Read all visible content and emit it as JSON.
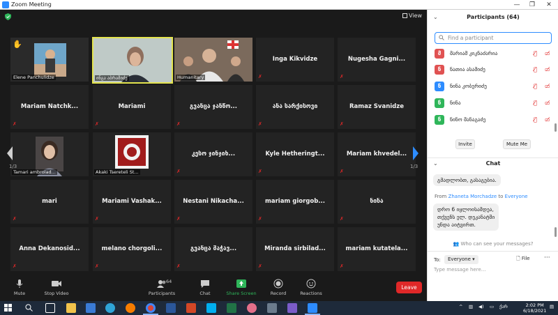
{
  "window": {
    "title": "Zoom Meeting",
    "min": "—",
    "restore": "❐",
    "close": "✕"
  },
  "stage": {
    "view_label": "View"
  },
  "tiles": [
    {
      "text": "Elene Panchulidze",
      "kind": "photo-label"
    },
    {
      "text": "ინგა აბრამიძე",
      "kind": "photo-label"
    },
    {
      "text": "Humanitary",
      "kind": "photo-label"
    },
    {
      "text": "Inga Kikvidze",
      "kind": "name"
    },
    {
      "text": "Nugesha Gagni...",
      "kind": "name"
    },
    {
      "text": "Mariam Natchk...",
      "kind": "name"
    },
    {
      "text": "Mariami",
      "kind": "name"
    },
    {
      "text": "გვანცა ჯანწო...",
      "kind": "name"
    },
    {
      "text": "ანა სარქისოვი",
      "kind": "name"
    },
    {
      "text": "Ramaz Svanidze",
      "kind": "name"
    },
    {
      "text": "Tamari ambrolad...",
      "kind": "photo-label"
    },
    {
      "text": "Akaki Tsereteli St...",
      "kind": "photo-label"
    },
    {
      "text": "კესო ჯინჯიხ...",
      "kind": "name"
    },
    {
      "text": "Kyle Hetheringt...",
      "kind": "name"
    },
    {
      "text": "Mariam khvedel...",
      "kind": "name"
    },
    {
      "text": "mari",
      "kind": "name"
    },
    {
      "text": "Mariami Vashak...",
      "kind": "name"
    },
    {
      "text": "Nestani Nikacha...",
      "kind": "name"
    },
    {
      "text": "mariam giorgob...",
      "kind": "name"
    },
    {
      "text": "ნინა",
      "kind": "name"
    },
    {
      "text": "Anna Dekanosid...",
      "kind": "name"
    },
    {
      "text": "melano chorgoli...",
      "kind": "name"
    },
    {
      "text": "გვანცა მაჭავ...",
      "kind": "name"
    },
    {
      "text": "Miranda sirbilad...",
      "kind": "name"
    },
    {
      "text": "mariam kutatela...",
      "kind": "name"
    }
  ],
  "pagination": {
    "left": "1/3",
    "right": "1/3"
  },
  "toolbar": {
    "mute": "Mute",
    "stop_video": "Stop Video",
    "participants": "Participants",
    "participants_count": "64",
    "chat": "Chat",
    "share_screen": "Share Screen",
    "record": "Record",
    "reactions": "Reactions",
    "leave": "Leave"
  },
  "participants_panel": {
    "title": "Participants (64)",
    "search_placeholder": "Find a participant",
    "rows": [
      {
        "initial": "მ",
        "name": "მარიამ კიკნაძარია",
        "color": "#e05252"
      },
      {
        "initial": "ნ",
        "name": "ნათია ასამიძე",
        "color": "#e05252"
      },
      {
        "initial": "ნ",
        "name": "ნინა კობერიძე",
        "color": "#2d8cff"
      },
      {
        "initial": "ნ",
        "name": "ნინა",
        "color": "#2fb65a"
      },
      {
        "initial": "ნ",
        "name": "ნინო მანაგაძე",
        "color": "#2fb65a"
      }
    ],
    "invite": "Invite",
    "mute_me": "Mute Me"
  },
  "chat_panel": {
    "title": "Chat",
    "msg1": "გმადლობთ, გასაგებია.",
    "from_prefix": "From",
    "from_name": "Zhaneta Morchadze",
    "from_to": "to",
    "from_target": "Everyone",
    "msg2_line1": "დრო 6 იყლოისამდეა,",
    "msg2_line2": "თქვენს ელ. დეკანატში",
    "msg2_line3": "უნდა აიტვირთ.",
    "who_can_see": "Who can see your messages?",
    "to_label": "To:",
    "to_value": "Everyone",
    "file_label": "File",
    "more": "···",
    "input_placeholder": "Type message here..."
  },
  "taskbar": {
    "lang": "ქარ",
    "time": "2:02 PM",
    "date": "6/18/2021",
    "tray_up": "^"
  }
}
